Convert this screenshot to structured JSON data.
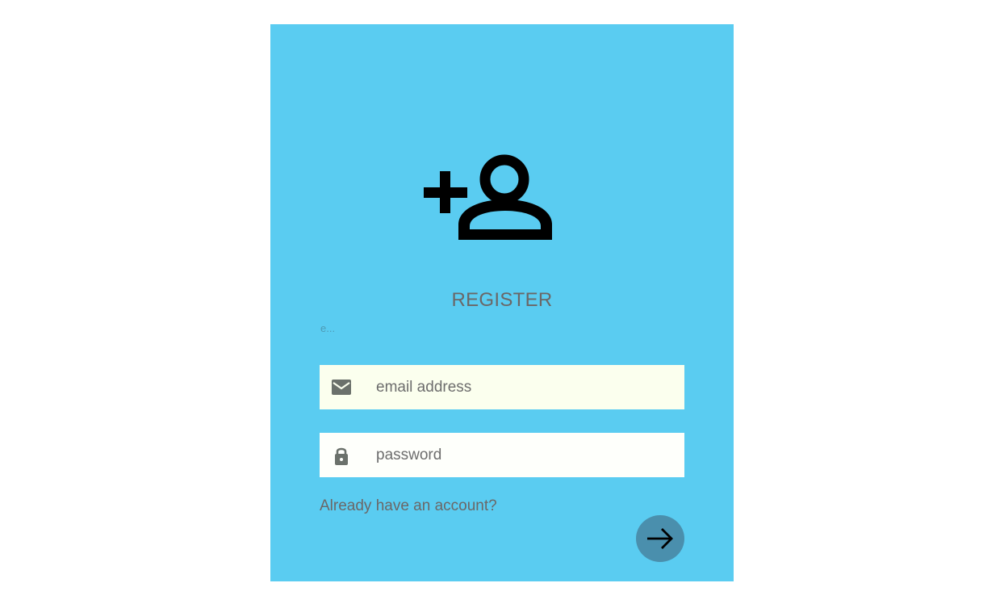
{
  "header": {
    "icon": "add-user-icon"
  },
  "form": {
    "title": "REGISTER",
    "hint": "e...",
    "email": {
      "icon": "mail-icon",
      "placeholder": "email address",
      "value": ""
    },
    "password": {
      "icon": "lock-icon",
      "placeholder": "password",
      "value": ""
    },
    "login_link": "Already have an account?",
    "submit_icon": "arrow-right-icon"
  },
  "colors": {
    "page_background": "#ffffff",
    "card_background": "#5accf1",
    "submit_button": "#4a8fad",
    "email_field": "#fbffee",
    "password_field": "#fefffb",
    "text_muted": "#6b6767"
  }
}
